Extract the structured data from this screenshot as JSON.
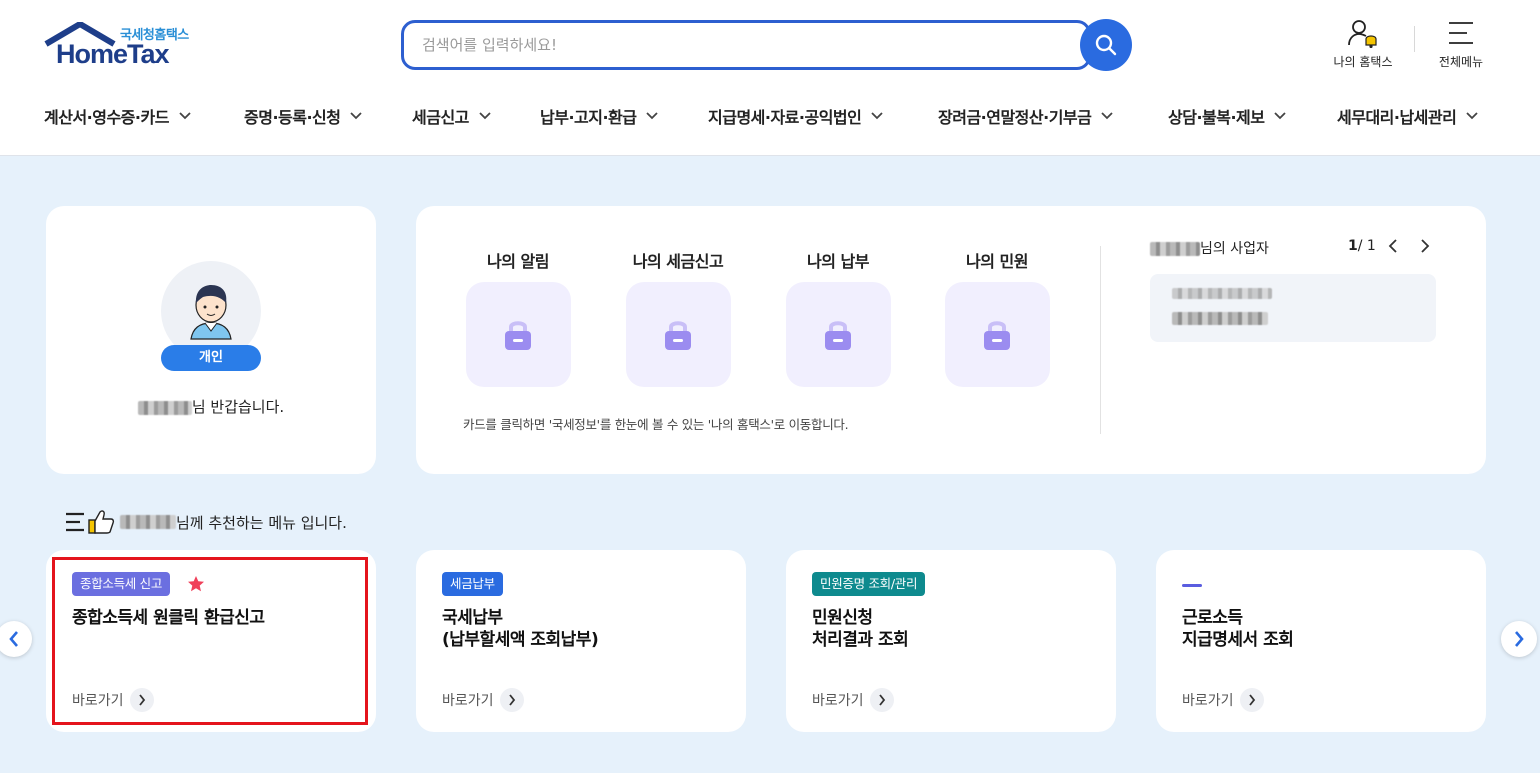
{
  "header": {
    "logo_sub": "국세청홈택스",
    "logo_main": "HomeTax",
    "search_placeholder": "검색어를 입력하세요!",
    "util_my_hometax": "나의 홈택스",
    "util_all_menu": "전체메뉴"
  },
  "gnb": [
    "계산서·영수증·카드",
    "증명·등록·신청",
    "세금신고",
    "납부·고지·환급",
    "지급명세·자료·공익법인",
    "장려금·연말정산·기부금",
    "상담·불복·제보",
    "세무대리·납세관리"
  ],
  "profile": {
    "type_badge": "개인",
    "greeting_suffix": "님 반갑습니다."
  },
  "my_home": {
    "items": [
      "나의 알림",
      "나의 세금신고",
      "나의 납부",
      "나의 민원"
    ],
    "note": "카드를 클릭하면 '국세정보'를 한눈에 볼 수 있는 '나의 홈택스'로 이동합니다.",
    "business_title_suffix": "님의 사업자",
    "pager_current": "1",
    "pager_total": " / 1"
  },
  "recommend": {
    "title_suffix": "님께 추천하는 메뉴 입니다.",
    "cards": [
      {
        "tag": "종합소득세 신고",
        "tag_color": "#6b6fe0",
        "name_line1": "종합소득세 원클릭 환급신고",
        "name_line2": "",
        "go": "바로가기"
      },
      {
        "tag": "세금납부",
        "tag_color": "#2a6be0",
        "name_line1": "국세납부",
        "name_line2": "(납부할세액 조회납부)",
        "go": "바로가기"
      },
      {
        "tag": "민원증명 조회/관리",
        "tag_color": "#0e8a8e",
        "name_line1": "민원신청",
        "name_line2": "처리결과 조회",
        "go": "바로가기"
      },
      {
        "tag": "",
        "tag_color": "#5a5de0",
        "name_line1": "근로소득",
        "name_line2": "지급명세서 조회",
        "go": "바로가기"
      }
    ]
  },
  "colors": {
    "primary": "#2a6be0",
    "navy": "#1e3e8a",
    "background": "#e6f1fb",
    "highlight": "#e4141c",
    "lock": "#9b8cf0"
  }
}
